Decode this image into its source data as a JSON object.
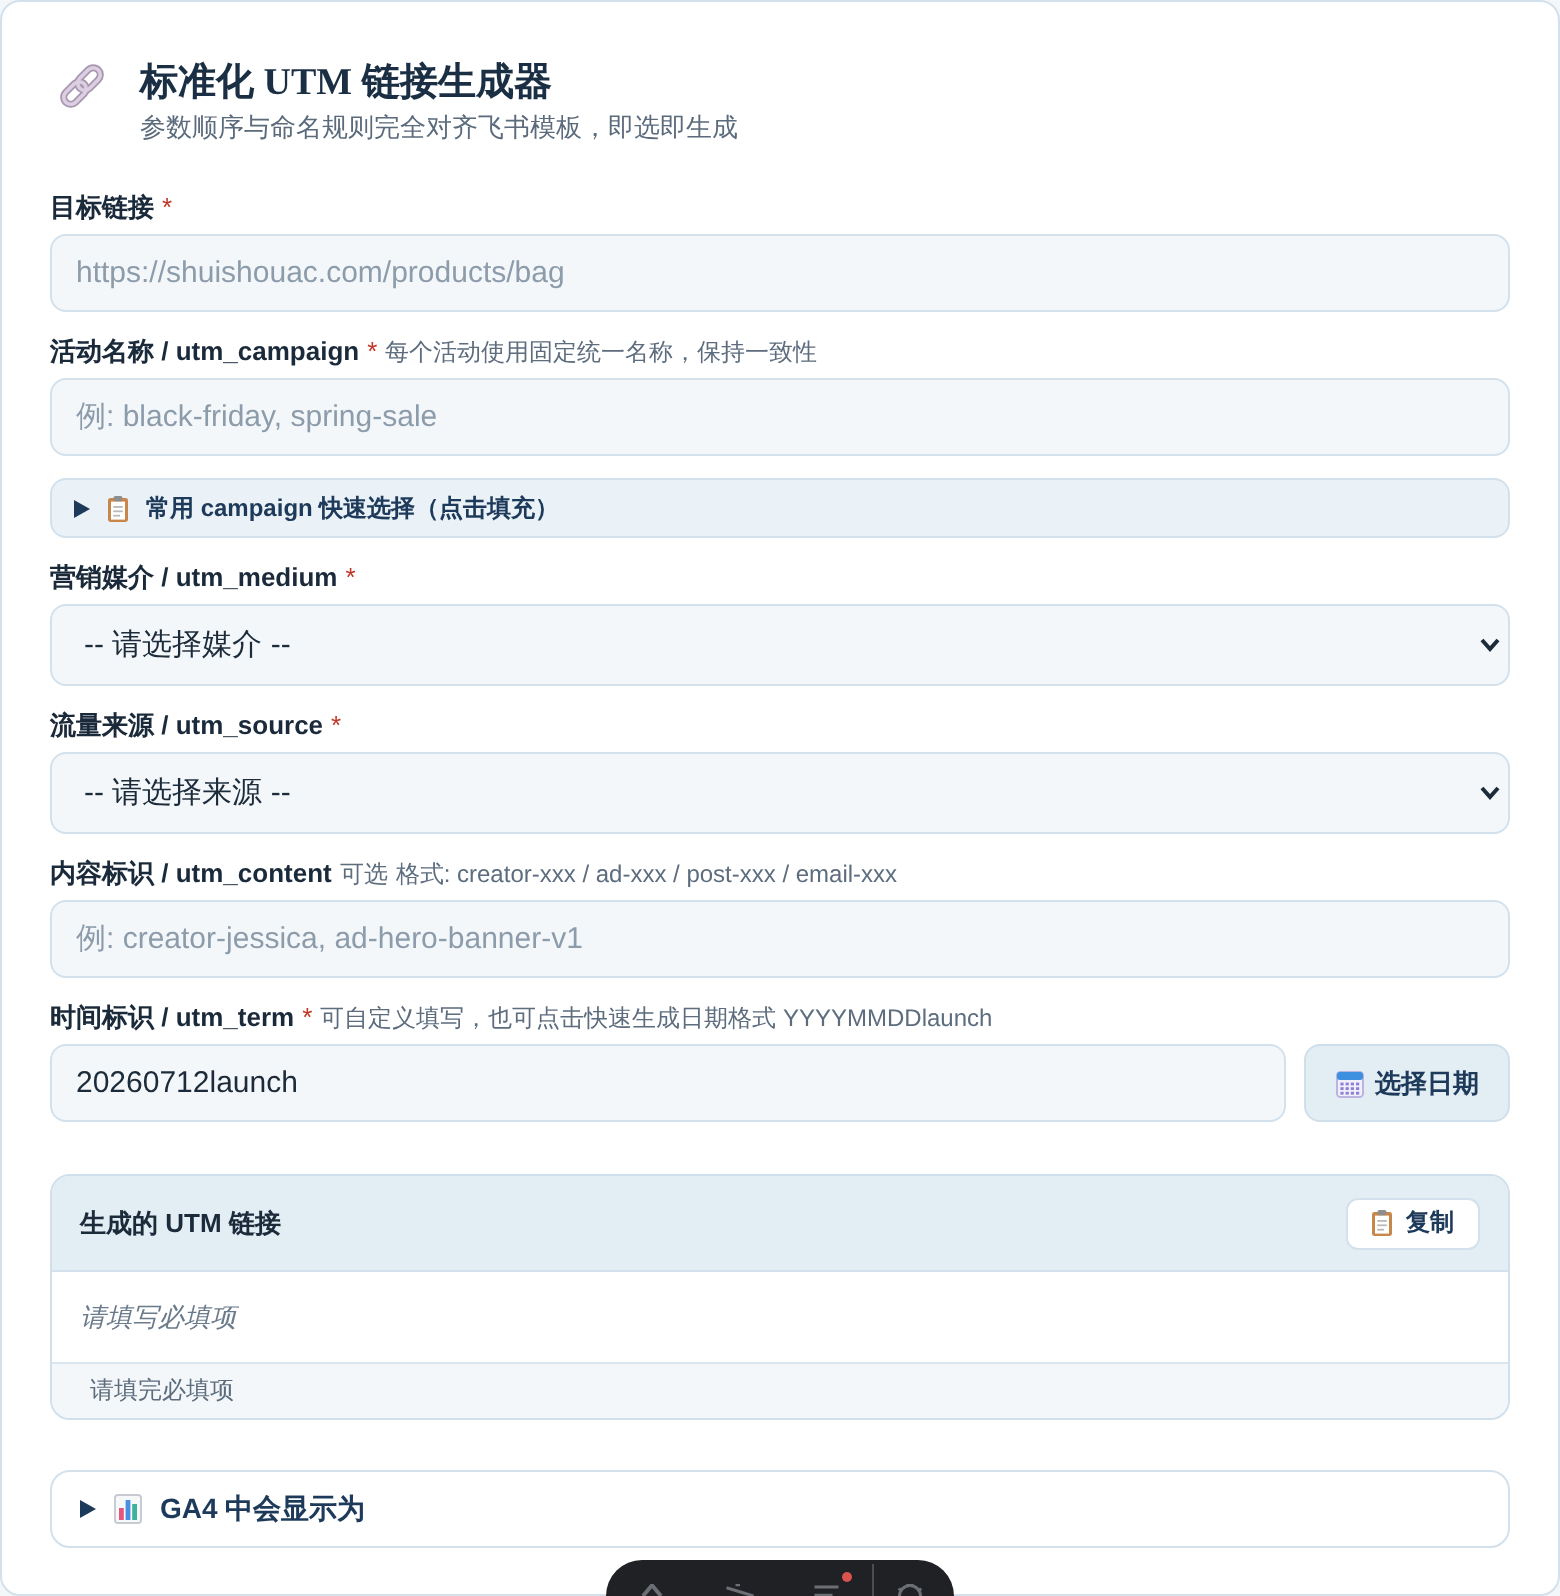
{
  "header": {
    "title": "标准化 UTM 链接生成器",
    "subtitle": "参数顺序与命名规则完全对齐飞书模板，即选即生成"
  },
  "fields": [
    {
      "kind": "input",
      "label": "目标链接",
      "required_mark": "*",
      "placeholder": "https://shuishouac.com/products/bag"
    },
    {
      "kind": "input",
      "label": "活动名称 / utm_campaign",
      "required_mark": "*",
      "hint": "每个活动使用固定统一名称，保持一致性",
      "placeholder": "例: black-friday, spring-sale"
    },
    {
      "kind": "disclosure",
      "label": "常用 campaign 快速选择（点击填充）",
      "expanded": false
    },
    {
      "kind": "select",
      "label": "营销媒介 / utm_medium",
      "required_mark": "*",
      "value": "-- 请选择媒介 --"
    },
    {
      "kind": "select",
      "label": "流量来源 / utm_source",
      "required_mark": "*",
      "value": "-- 请选择来源 --"
    },
    {
      "kind": "input",
      "label": "内容标识 / utm_content",
      "optional": "可选",
      "hint": "格式: creator-xxx / ad-xxx / post-xxx / email-xxx",
      "placeholder": "例: creator-jessica, ad-hero-banner-v1"
    },
    {
      "kind": "input_with_button",
      "label": "时间标识 / utm_term",
      "required_mark": "*",
      "hint": "可自定义填写，也可点击快速生成日期格式 YYYYMMDDlaunch",
      "value": "20260712launch",
      "button": "选择日期"
    }
  ],
  "result": {
    "title": "生成的 UTM 链接",
    "copy_button": "复制",
    "output": "请填写必填项",
    "status": "请填完必填项"
  },
  "ga4_preview": {
    "label": "GA4 中会显示为",
    "expanded": false
  }
}
